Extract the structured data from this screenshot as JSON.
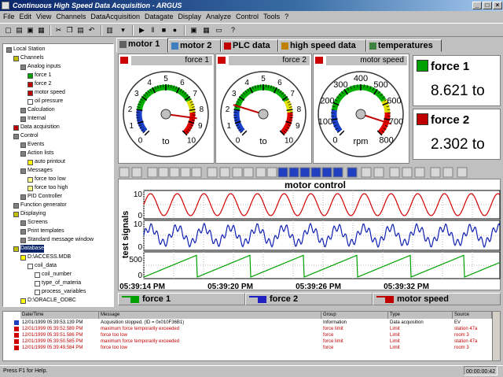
{
  "window": {
    "title": "Continuous High Speed Data Acquisition - ARGUS"
  },
  "menu": [
    "File",
    "Edit",
    "View",
    "Channels",
    "DataAcquisition",
    "Datagate",
    "Display",
    "Analyze",
    "Control",
    "Tools",
    "?"
  ],
  "tree": [
    {
      "label": "Local Station",
      "level": 0,
      "color": "#808080"
    },
    {
      "label": "Channels",
      "level": 1,
      "color": "#c0c000"
    },
    {
      "label": "Analog inputs",
      "level": 2,
      "color": "#808080"
    },
    {
      "label": "force 1",
      "level": 3,
      "color": "#00a000"
    },
    {
      "label": "force 2",
      "level": 3,
      "color": "#c00000"
    },
    {
      "label": "motor speed",
      "level": 3,
      "color": "#c00000"
    },
    {
      "label": "oil pressure",
      "level": 3,
      "color": "#ffffff"
    },
    {
      "label": "Calculation",
      "level": 2,
      "color": "#808080"
    },
    {
      "label": "Internal",
      "level": 2,
      "color": "#808080"
    },
    {
      "label": "Data acquisition",
      "level": 1,
      "color": "#c00000"
    },
    {
      "label": "Control",
      "level": 1,
      "color": "#808080"
    },
    {
      "label": "Events",
      "level": 2,
      "color": "#808080"
    },
    {
      "label": "Action lists",
      "level": 2,
      "color": "#808080"
    },
    {
      "label": "auto printout",
      "level": 3,
      "color": "#ffff00"
    },
    {
      "label": "Messages",
      "level": 2,
      "color": "#808080"
    },
    {
      "label": "force too low",
      "level": 3,
      "color": "#ffff80"
    },
    {
      "label": "force too high",
      "level": 3,
      "color": "#ffff80"
    },
    {
      "label": "PID Controller",
      "level": 2,
      "color": "#808080"
    },
    {
      "label": "Function generator",
      "level": 1,
      "color": "#808080"
    },
    {
      "label": "Displaying",
      "level": 1,
      "color": "#c0c000"
    },
    {
      "label": "Screens",
      "level": 2,
      "color": "#808080"
    },
    {
      "label": "Print templates",
      "level": 2,
      "color": "#808080"
    },
    {
      "label": "Standard message window",
      "level": 2,
      "color": "#808080"
    },
    {
      "label": "Database",
      "level": 1,
      "color": "#c0c000",
      "selected": true
    },
    {
      "label": "D:\\ACCESS.MDB",
      "level": 2,
      "color": "#ffff00"
    },
    {
      "label": "coil_data",
      "level": 3,
      "color": "#ffffff"
    },
    {
      "label": "coil_number",
      "level": 4,
      "color": "#ffffff"
    },
    {
      "label": "type_of_materia",
      "level": 4,
      "color": "#ffffff"
    },
    {
      "label": "process_variables",
      "level": 4,
      "color": "#ffffff"
    },
    {
      "label": "D:\\ORACLE_ODBC",
      "level": 2,
      "color": "#ffff00"
    }
  ],
  "tabs": [
    {
      "label": "motor 1",
      "active": true,
      "icon": "wrench-icon"
    },
    {
      "label": "motor 2",
      "icon": "screen-icon"
    },
    {
      "label": "PLC data",
      "icon": "flag-icon"
    },
    {
      "label": "high speed data",
      "icon": "pencil-icon"
    },
    {
      "label": "temperatures",
      "icon": "gear-icon"
    }
  ],
  "gauges": [
    {
      "title": "force 1",
      "unit": "to",
      "min": 0,
      "max": 10,
      "value": 8.621,
      "ticks": [
        "0",
        "1",
        "2",
        "3",
        "4",
        "5",
        "6",
        "7",
        "8",
        "9",
        "10"
      ]
    },
    {
      "title": "force 2",
      "unit": "to",
      "min": 0,
      "max": 10,
      "value": 2.302,
      "ticks": [
        "0",
        "1",
        "2",
        "3",
        "4",
        "5",
        "6",
        "7",
        "8",
        "9",
        "10"
      ]
    },
    {
      "title": "motor speed",
      "unit": "rpm",
      "min": 0,
      "max": 800,
      "value": 720,
      "ticks": [
        "0",
        "100",
        "200",
        "300",
        "400",
        "500",
        "600",
        "700",
        "800"
      ]
    }
  ],
  "digital": [
    {
      "title": "force 1",
      "value": "8.621 to",
      "color": "#00a000"
    },
    {
      "title": "force 2",
      "value": "2.302 to",
      "color": "#c00000"
    }
  ],
  "chart": {
    "title": "motor control",
    "ylabel": "test signals",
    "xticks": [
      "05:39:14 PM",
      "05:39:20 PM",
      "05:39:26 PM",
      "05:39:32 PM"
    ],
    "yticks": [
      "10",
      "0",
      "10",
      "0",
      "500",
      "0"
    ]
  },
  "legend": [
    {
      "label": "force 1",
      "color": "#00a000"
    },
    {
      "label": "force 2",
      "color": "#2020c0"
    },
    {
      "label": "motor speed",
      "color": "#c00000"
    }
  ],
  "log": {
    "headers": [
      "Date/Time",
      "Message",
      "Group",
      "Type",
      "Source"
    ],
    "rows": [
      {
        "time": "12/01/1999 05:39:53.139 PM",
        "msg": "Acquisition stopped. (ID = 0x010F36B1)",
        "group": "Information",
        "type": "Data acquisition",
        "source": "EV",
        "color": "#000000"
      },
      {
        "time": "12/01/1999 05:39:52.589 PM",
        "msg": "maximum force temporarily exceeded",
        "group": "force limit",
        "type": "Limit",
        "source": "station 47a",
        "color": "#c00000"
      },
      {
        "time": "12/01/1999 05:39:51.586 PM",
        "msg": "force too low",
        "group": "force",
        "type": "Limit",
        "source": "room 3",
        "color": "#c00000"
      },
      {
        "time": "12/01/1999 05:39:50.585 PM",
        "msg": "maximum force temporarily exceeded",
        "group": "force limit",
        "type": "Limit",
        "source": "station 47a",
        "color": "#c00000"
      },
      {
        "time": "12/01/1999 05:39:49.584 PM",
        "msg": "force too low",
        "group": "force",
        "type": "Limit",
        "source": "room 3",
        "color": "#c00000"
      }
    ]
  },
  "status": {
    "left": "Press F1 for Help.",
    "right": "00:00:00:42"
  }
}
